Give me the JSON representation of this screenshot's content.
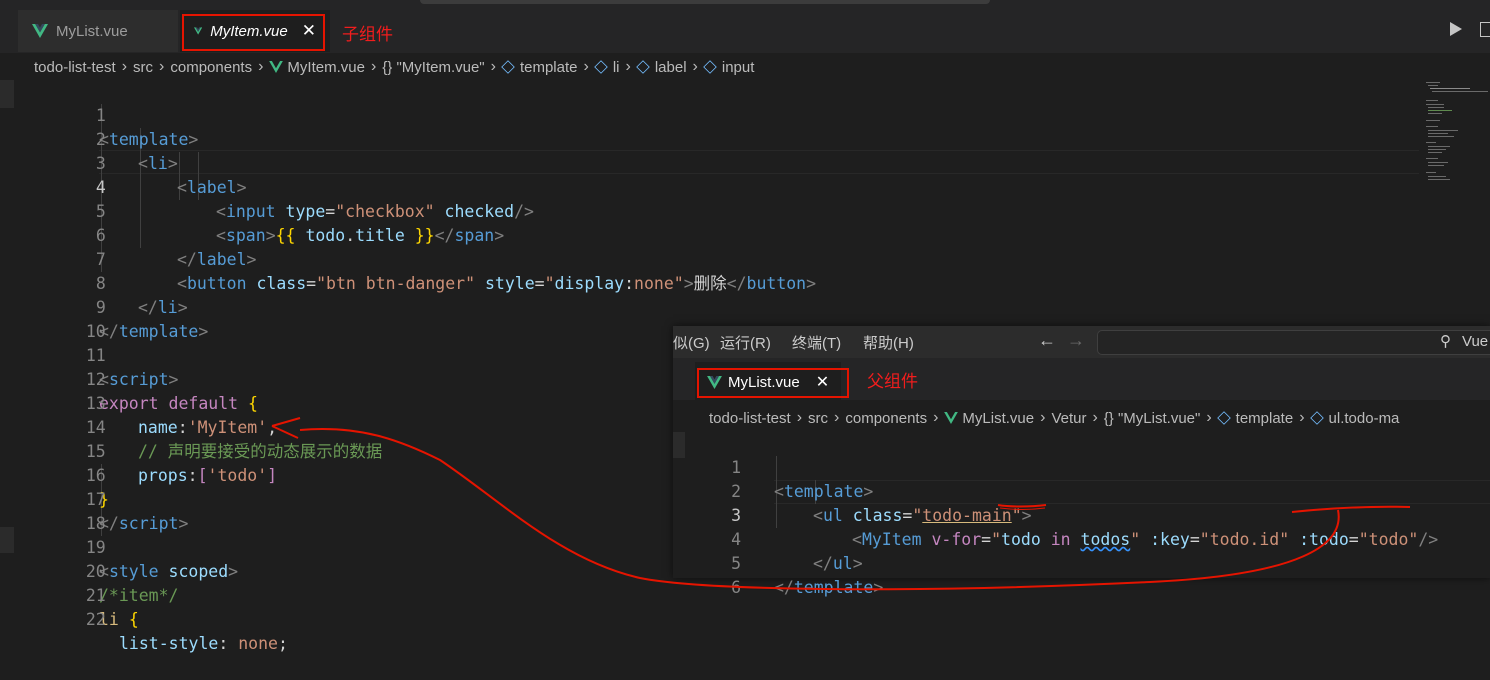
{
  "main_tabs": [
    {
      "label": "MyList.vue",
      "active": false
    },
    {
      "label": "MyItem.vue",
      "active": true
    }
  ],
  "annotations": {
    "child": "子组件",
    "parent": "父组件"
  },
  "breadcrumb": [
    "todo-list-test",
    "src",
    "components",
    "MyItem.vue",
    "{} \"MyItem.vue\"",
    "template",
    "li",
    "label",
    "input"
  ],
  "code_lines": [
    {
      "n": "1"
    },
    {
      "n": "2"
    },
    {
      "n": "3"
    },
    {
      "n": "4"
    },
    {
      "n": "5"
    },
    {
      "n": "6"
    },
    {
      "n": "7"
    },
    {
      "n": "8"
    },
    {
      "n": "9"
    },
    {
      "n": "10"
    },
    {
      "n": "11"
    },
    {
      "n": "12"
    },
    {
      "n": "13"
    },
    {
      "n": "14"
    },
    {
      "n": "15"
    },
    {
      "n": "16"
    },
    {
      "n": "17"
    },
    {
      "n": "18"
    },
    {
      "n": "19"
    },
    {
      "n": "20"
    },
    {
      "n": "21"
    },
    {
      "n": "22"
    }
  ],
  "code": {
    "l1": [
      "<",
      "template",
      ">"
    ],
    "l2": [
      "<",
      "li",
      ">"
    ],
    "l3": [
      "<",
      "label",
      ">"
    ],
    "l4": [
      "<",
      "input",
      "type",
      "=",
      "\"checkbox\"",
      "checked",
      "/>"
    ],
    "l5": [
      "<",
      "span",
      ">",
      "{{",
      "todo",
      ".",
      "title",
      "}}",
      "</",
      "span",
      ">"
    ],
    "l6": [
      "</",
      "label",
      ">"
    ],
    "l7": [
      "<",
      "button",
      "class",
      "=",
      "\"btn btn-danger\"",
      "style",
      "=",
      "\"",
      "display",
      ":",
      "none",
      "\"",
      ">",
      "删除",
      "</",
      "button",
      ">"
    ],
    "l8": [
      "</",
      "li",
      ">"
    ],
    "l9": [
      "</",
      "template",
      ">"
    ],
    "l11": [
      "<",
      "script",
      ">"
    ],
    "l12": [
      "export",
      "default",
      "{"
    ],
    "l13": [
      "name",
      ":",
      "'MyItem'",
      ","
    ],
    "l14": "// 声明要接受的动态展示的数据",
    "l15": [
      "props",
      ":",
      "[",
      "'todo'",
      "]"
    ],
    "l16": "}",
    "l17": [
      "</",
      "script",
      ">"
    ],
    "l19": [
      "<",
      "style",
      "scoped",
      ">"
    ],
    "l20": "/*item*/",
    "l21": [
      "li",
      "{"
    ],
    "l22": [
      "list-style",
      ":",
      "none",
      ";"
    ]
  },
  "popup": {
    "menu": [
      "似(G)",
      "运行(R)",
      "终端(T)",
      "帮助(H)"
    ],
    "search_hint": "Vue",
    "tab": "MyList.vue",
    "breadcrumb": [
      "todo-list-test",
      "src",
      "components",
      "MyList.vue",
      "Vetur",
      "{} \"MyList.vue\"",
      "template",
      "ul.todo-ma"
    ],
    "line_numbers": [
      "1",
      "2",
      "3",
      "4",
      "5",
      "6"
    ],
    "code": {
      "l1": [
        "<",
        "template",
        ">"
      ],
      "l2": [
        "<",
        "ul",
        "class",
        "=",
        "\"",
        "todo-main",
        "\"",
        ">"
      ],
      "l3": [
        "<",
        "MyItem",
        "v-for",
        "=",
        "\"",
        "todo",
        "in",
        "todos",
        "\"",
        ":key",
        "=",
        "\"todo.id\"",
        ":todo",
        "=",
        "\"todo\"",
        "/>"
      ],
      "l4": [
        "</",
        "ul",
        ">"
      ],
      "l5": [
        "</",
        "template",
        ">"
      ]
    }
  },
  "colors": {
    "editor_bg": "#1e1e1e",
    "tab_bg": "#252526",
    "annotation_red": "#f21d1d",
    "vue_green": "#41b883"
  }
}
